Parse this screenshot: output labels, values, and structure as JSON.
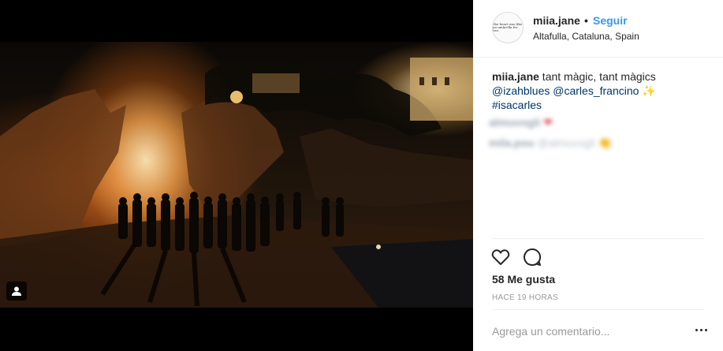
{
  "post": {
    "username": "miia.jane",
    "separator": "•",
    "follow_label": "Seguir",
    "location": "Altafulla, Cataluna, Spain",
    "avatar_text": [
      "the heart was like",
      "an umbrella for two"
    ],
    "caption": {
      "username": "miia.jane",
      "text": " tant màgic, tant màgics ",
      "mention1": "@izahblues",
      "mention2": "@carles_francino",
      "emoji": " ✨",
      "hashtag": "#isacarles"
    },
    "blurred_comments": [
      {
        "user": "almuvogli",
        "text": "",
        "emoji": "❤"
      },
      {
        "user": "mila.pou",
        "text": "@almuvogli",
        "emoji": "👏"
      }
    ],
    "likes": "58 Me gusta",
    "time": "HACE 19 HORAS",
    "comment_placeholder": "Agrega un comentario...",
    "icons": {
      "like": "heart-icon",
      "comment": "comment-icon",
      "tag": "user-tag-icon",
      "more": "more-options-icon"
    }
  }
}
